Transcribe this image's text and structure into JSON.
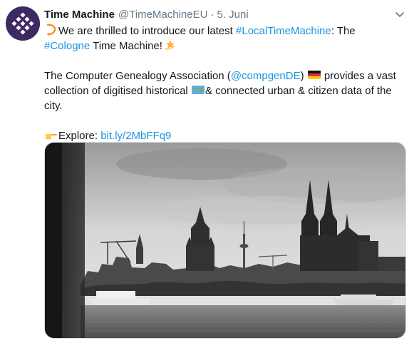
{
  "author": {
    "name": "Time Machine",
    "handle": "@TimeMachineEU",
    "separator": "·",
    "date": "5. Juni"
  },
  "tweet": {
    "line1_text": "We are thrilled to introduce our latest ",
    "hashtag_local": "#LocalTimeMachine",
    "line1_after": ": The",
    "hashtag_cologne": "#Cologne",
    "line2_after": " Time Machine!",
    "para2_before": "The Computer Genealogy Association (",
    "mention": "@compgenDE",
    "para2_mid": ") ",
    "para2_after_flag": " provides a vast collection of digitised historical ",
    "para2_after_map": "& connected urban & citizen data of the city.",
    "explore_label": "Explore: ",
    "explore_link": "bit.ly/2MbFFq9"
  },
  "icons": {
    "avatar": "time-machine-logo",
    "caret": "chevron-down-icon",
    "emoji_start": "hourglass-emoji",
    "emoji_end": "dizzy-star-emoji",
    "flag": "germany-flag-emoji",
    "map": "world-map-emoji",
    "pointer": "backhand-index-pointing-right-emoji"
  },
  "colors": {
    "link": "#1b95e0",
    "text": "#14171a",
    "muted": "#657786",
    "avatar_bg": "#3d2a63"
  }
}
